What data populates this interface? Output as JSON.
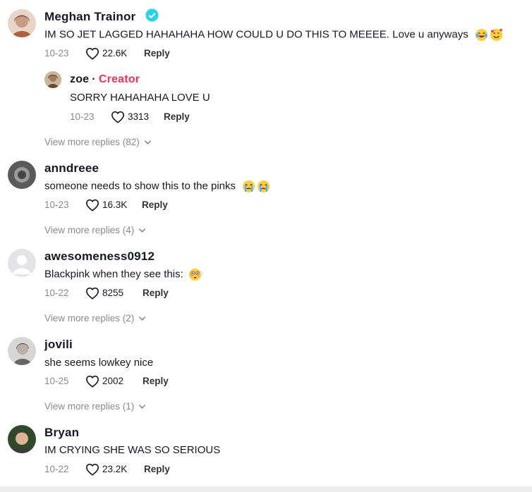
{
  "comments": [
    {
      "username": "Meghan Trainor",
      "verified": true,
      "text": "IM SO JET LAGGED HAHAHAHA HOW COULD U DO THIS TO MEEEE. Love u anyways",
      "emojis": [
        "laughing-emoji",
        "smiling-hearts-emoji"
      ],
      "date": "10-23",
      "likes": "22.6K",
      "reply_label": "Reply"
    },
    {
      "username": "zoe",
      "badge": "Creator",
      "text": "SORRY HAHAHAHA LOVE U",
      "date": "10-23",
      "likes": "3313",
      "reply_label": "Reply",
      "more": "View more replies (82)"
    },
    {
      "username": "anndreee",
      "text": "someone needs to show this to the pinks",
      "emojis": [
        "crying-emoji",
        "crying-emoji"
      ],
      "date": "10-23",
      "likes": "16.3K",
      "reply_label": "Reply",
      "more": "View more replies (4)"
    },
    {
      "username": "awesomeness0912",
      "text": "Blackpink when they see this:",
      "emojis": [
        "flushed-emoji"
      ],
      "date": "10-22",
      "likes": "8255",
      "reply_label": "Reply",
      "more": "View more replies (2)"
    },
    {
      "username": "jovili",
      "text": "she seems lowkey nice",
      "date": "10-25",
      "likes": "2002",
      "reply_label": "Reply",
      "more": "View more replies (1)"
    },
    {
      "username": "Bryan",
      "text": "IM CRYING SHE WAS SO SERIOUS",
      "date": "10-22",
      "likes": "23.2K",
      "reply_label": "Reply"
    }
  ],
  "colors": {
    "creator": "#fe2c55",
    "verified": "#20d5ec",
    "muted": "#8a8b91"
  }
}
